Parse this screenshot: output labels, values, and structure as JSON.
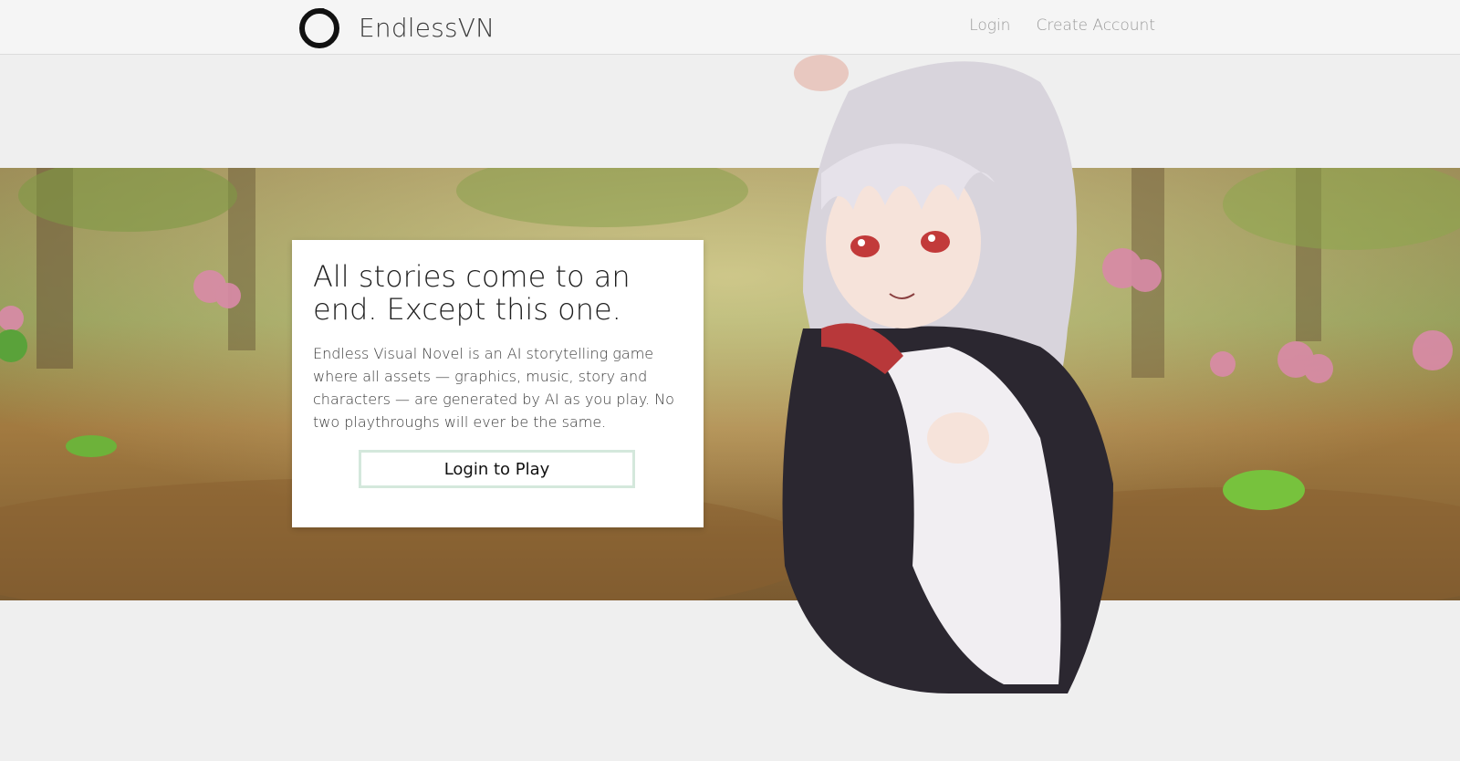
{
  "header": {
    "brand_name": "EndlessVN",
    "logo_icon": "ouroboros-icon",
    "nav": [
      {
        "label": "Login"
      },
      {
        "label": "Create Account"
      }
    ]
  },
  "hero": {
    "headline": "All stories come to an end. Except this one.",
    "description": "Endless Visual Novel is an AI storytelling game where all assets — graphics, music, story and characters — are generated by AI as you play. No two playthroughs will ever be the same.",
    "cta_label": "Login to Play"
  },
  "colors": {
    "page_bg": "#efefef",
    "navbar_bg": "#f5f5f5",
    "cta_border": "#d4e8dc",
    "brand_text": "#3a3a3a",
    "nav_text": "#9a9a9a"
  }
}
